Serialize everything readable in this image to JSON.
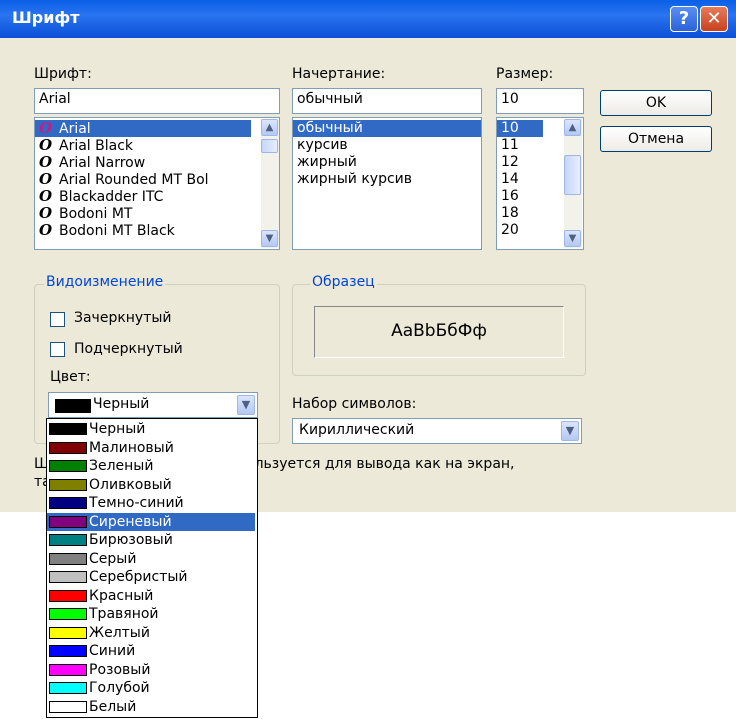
{
  "window": {
    "title": "Шрифт",
    "help": "?",
    "close": "✕"
  },
  "font": {
    "label": "Шрифт:",
    "value": "Arial",
    "items": [
      {
        "name": "Arial",
        "icon": "opentype-icon"
      },
      {
        "name": "Arial Black",
        "icon": "opentype-icon"
      },
      {
        "name": "Arial Narrow",
        "icon": "opentype-icon"
      },
      {
        "name": "Arial Rounded MT Bol",
        "icon": "opentype-icon"
      },
      {
        "name": "Blackadder ITC",
        "icon": "opentype-icon"
      },
      {
        "name": "Bodoni MT",
        "icon": "opentype-icon"
      },
      {
        "name": "Bodoni MT Black",
        "icon": "opentype-icon"
      }
    ],
    "selected": "Arial",
    "icon_glyph": "O"
  },
  "style": {
    "label": "Начертание:",
    "value": "обычный",
    "items": [
      "обычный",
      "курсив",
      "жирный",
      "жирный курсив"
    ],
    "selected": "обычный"
  },
  "size": {
    "label": "Размер:",
    "value": "10",
    "items": [
      "10",
      "11",
      "12",
      "14",
      "16",
      "18",
      "20"
    ],
    "selected": "10"
  },
  "buttons": {
    "ok": "OK",
    "cancel": "Отмена"
  },
  "effects": {
    "label": "Видоизменение",
    "strikeout": "Зачеркнутый",
    "underline": "Подчеркнутый",
    "color_label": "Цвет:",
    "color_value": "Черный",
    "color_swatch": "#000000"
  },
  "sample": {
    "label": "Образец",
    "text": "AaBbБбФф"
  },
  "charset": {
    "label": "Набор символов:",
    "value": "Кириллический"
  },
  "hint": {
    "prefix": "Ш",
    "middle": "ользуется для вывода как на экран,",
    "prefix2": "та"
  },
  "color_list": {
    "selected": "Сиреневый",
    "items": [
      {
        "name": "Черный",
        "color": "#000000"
      },
      {
        "name": "Малиновый",
        "color": "#800000"
      },
      {
        "name": "Зеленый",
        "color": "#008000"
      },
      {
        "name": "Оливковый",
        "color": "#808000"
      },
      {
        "name": "Темно-синий",
        "color": "#000080"
      },
      {
        "name": "Сиреневый",
        "color": "#800080"
      },
      {
        "name": "Бирюзовый",
        "color": "#008080"
      },
      {
        "name": "Серый",
        "color": "#808080"
      },
      {
        "name": "Серебристый",
        "color": "#c0c0c0"
      },
      {
        "name": "Красный",
        "color": "#ff0000"
      },
      {
        "name": "Травяной",
        "color": "#00ff00"
      },
      {
        "name": "Желтый",
        "color": "#ffff00"
      },
      {
        "name": "Синий",
        "color": "#0000ff"
      },
      {
        "name": "Розовый",
        "color": "#ff00ff"
      },
      {
        "name": "Голубой",
        "color": "#00ffff"
      },
      {
        "name": "Белый",
        "color": "#ffffff"
      }
    ]
  }
}
